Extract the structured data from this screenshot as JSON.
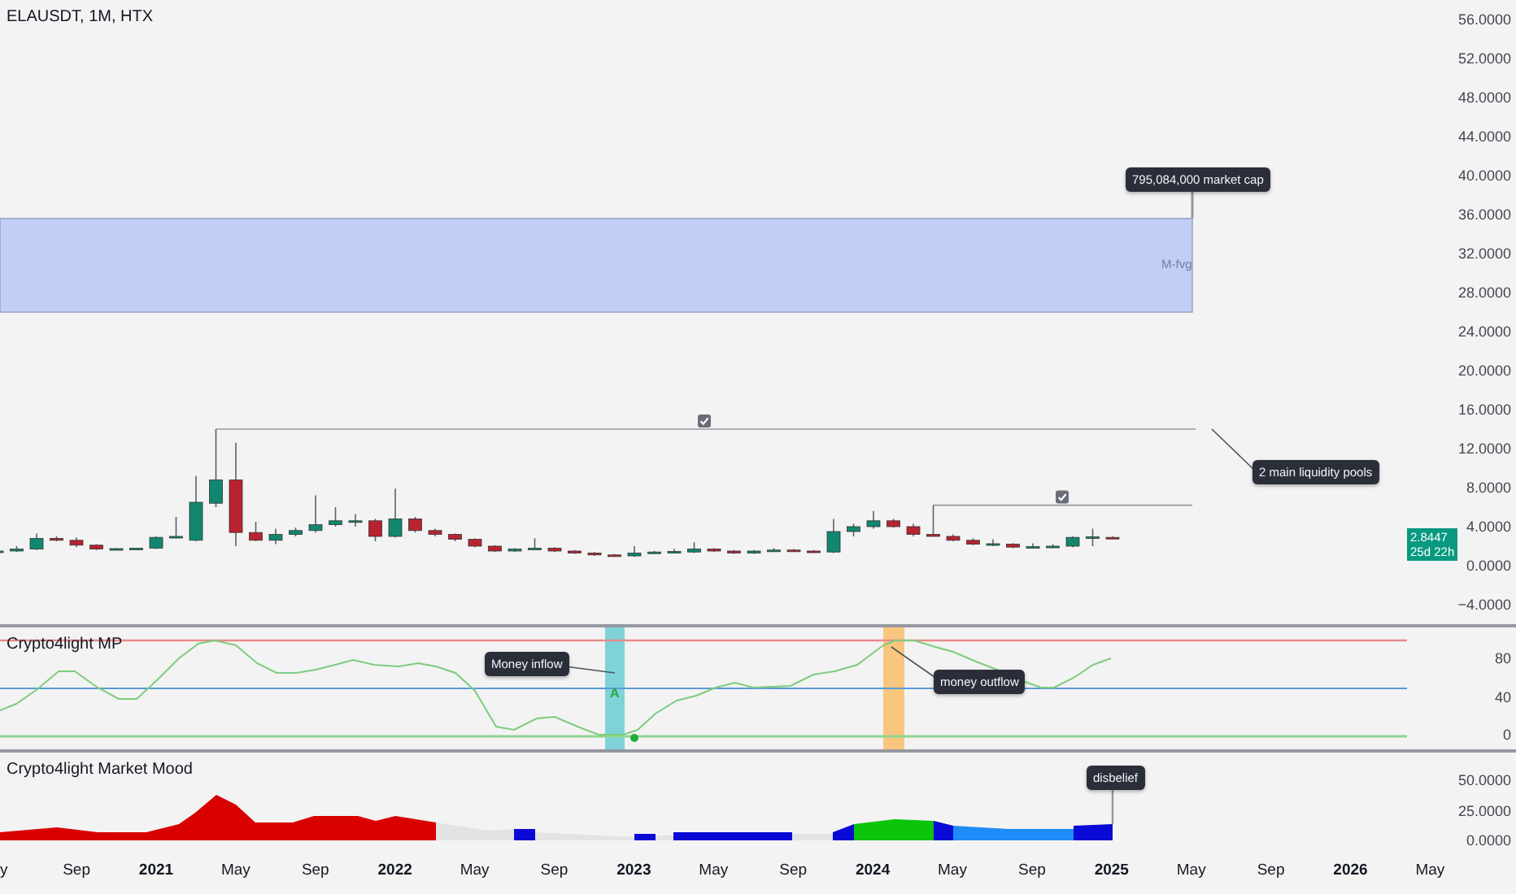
{
  "chart": {
    "title": "ELAUSDT, 1M, HTX",
    "price_axis": [
      "56.0000",
      "52.0000",
      "48.0000",
      "44.0000",
      "40.0000",
      "36.0000",
      "32.0000",
      "28.0000",
      "24.0000",
      "20.0000",
      "16.0000",
      "12.0000",
      "8.0000",
      "4.0000",
      "0.0000",
      "−4.0000"
    ],
    "price_tag": {
      "price": "2.8447",
      "countdown": "25d 22h"
    },
    "zone": {
      "label": "M-fvg"
    },
    "callouts": [
      "795,084,000 market cap",
      "2 main liquidity pools"
    ]
  },
  "indicators": [
    {
      "name": "Crypto4light MP",
      "axis": [
        "80",
        "40",
        "0"
      ],
      "markers": [
        "A"
      ],
      "callouts": [
        "Money inflow",
        "money outflow"
      ]
    },
    {
      "name": "Crypto4light Market Mood",
      "axis": [
        "50.0000",
        "25.0000",
        "0.0000"
      ],
      "callouts": [
        "disbelief"
      ]
    }
  ],
  "time_axis": [
    {
      "label": "y",
      "kind": "month"
    },
    {
      "label": "Sep",
      "kind": "month"
    },
    {
      "label": "2021",
      "kind": "year"
    },
    {
      "label": "May",
      "kind": "month"
    },
    {
      "label": "Sep",
      "kind": "month"
    },
    {
      "label": "2022",
      "kind": "year"
    },
    {
      "label": "May",
      "kind": "month"
    },
    {
      "label": "Sep",
      "kind": "month"
    },
    {
      "label": "2023",
      "kind": "year"
    },
    {
      "label": "May",
      "kind": "month"
    },
    {
      "label": "Sep",
      "kind": "month"
    },
    {
      "label": "2024",
      "kind": "year"
    },
    {
      "label": "May",
      "kind": "month"
    },
    {
      "label": "Sep",
      "kind": "month"
    },
    {
      "label": "2025",
      "kind": "year"
    },
    {
      "label": "May",
      "kind": "month"
    },
    {
      "label": "Sep",
      "kind": "month"
    },
    {
      "label": "2026",
      "kind": "year"
    },
    {
      "label": "May",
      "kind": "month"
    }
  ]
}
